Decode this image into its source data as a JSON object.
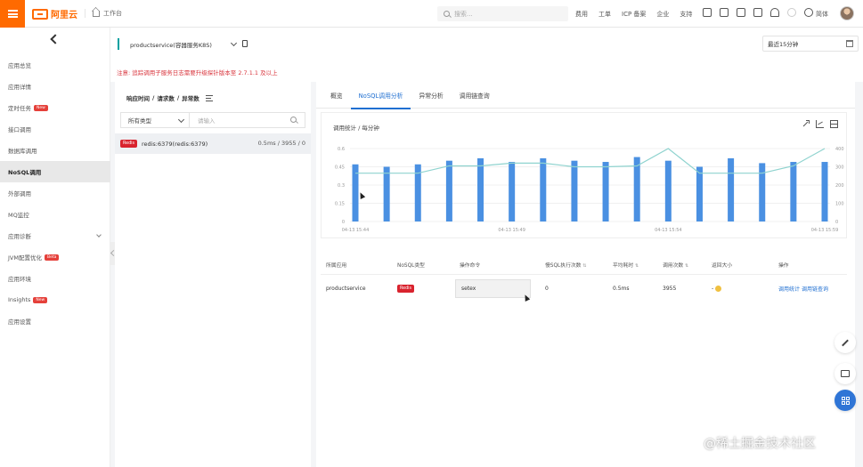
{
  "topbar": {
    "logo_text": "阿里云",
    "workbench": "工作台",
    "search_placeholder": "搜索...",
    "nav_links": [
      "费用",
      "工单",
      "ICP 备案",
      "企业",
      "支持"
    ],
    "lang": "简体"
  },
  "sidebar": {
    "items": [
      {
        "label": "应用总览",
        "badge": ""
      },
      {
        "label": "应用详情",
        "badge": ""
      },
      {
        "label": "定时任务",
        "badge": "New"
      },
      {
        "label": "接口调用",
        "badge": ""
      },
      {
        "label": "数据库调用",
        "badge": ""
      },
      {
        "label": "NoSQL调用",
        "badge": "",
        "active": true
      },
      {
        "label": "外部调用",
        "badge": ""
      },
      {
        "label": "MQ监控",
        "badge": ""
      },
      {
        "label": "应用诊断",
        "badge": "",
        "expandable": true
      },
      {
        "label": "JVM配置优化",
        "badge": "Beta"
      },
      {
        "label": "应用环境",
        "badge": ""
      },
      {
        "label": "Insights",
        "badge": "New"
      },
      {
        "label": "应用设置",
        "badge": ""
      }
    ]
  },
  "service_bar": {
    "service": "productservice(容器服务K8S)",
    "time_range": "最近15分钟"
  },
  "notice": "注意: 追踪调用子服务日志需要升级探针版本至 2.7.1.1 及以上",
  "left_panel": {
    "header": [
      "响应时间",
      "/",
      "请求数",
      "/",
      "异常数"
    ],
    "type_filter": "所有类型",
    "search_placeholder": "请输入",
    "rows": [
      {
        "tag": "Redis",
        "name": "redis:6379(redis:6379)",
        "stats": "0.5ms / 3955 / 0"
      }
    ]
  },
  "tabs": [
    "概览",
    "NoSQL调用分析",
    "异常分析",
    "调用链查询"
  ],
  "active_tab": 1,
  "chart": {
    "title": "调用统计 / 每分钟"
  },
  "chart_data": {
    "type": "bar",
    "categories": [
      "04-13 15:44",
      "",
      "",
      "",
      "",
      "04-13 15:49",
      "",
      "",
      "",
      "",
      "04-13 15:54",
      "",
      "",
      "",
      "",
      "04-13 15:59"
    ],
    "series": [
      {
        "name": "",
        "type": "bar",
        "axis": "left",
        "values": [
          0.47,
          0.45,
          0.47,
          0.5,
          0.52,
          0.49,
          0.52,
          0.5,
          0.49,
          0.53,
          0.5,
          0.45,
          0.52,
          0.48,
          0.49,
          0.49
        ]
      },
      {
        "name": "",
        "type": "line",
        "axis": "right",
        "values": [
          265,
          265,
          265,
          305,
          305,
          320,
          320,
          300,
          300,
          305,
          400,
          265,
          265,
          265,
          305,
          400
        ]
      }
    ],
    "y_left_ticks": [
      "0",
      "0.15",
      "0.3",
      "0.45",
      "0.6"
    ],
    "y_right_ticks": [
      "0",
      "100",
      "200",
      "300",
      "400"
    ],
    "x_ticks": [
      "04-13 15:44",
      "04-13 15:49",
      "04-13 15:54",
      "04-13 15:59"
    ],
    "ylim_left": [
      0,
      0.6
    ],
    "ylim_right": [
      0,
      400
    ],
    "colors": {
      "bar": "#4a90e2",
      "line": "#8fd3cf"
    }
  },
  "table": {
    "headers": [
      "所属应用",
      "NoSQL类型",
      "操作命令",
      "慢SQL执行次数",
      "平均耗时",
      "调用次数",
      "返回大小",
      "操作"
    ],
    "rows": [
      {
        "app": "productservice",
        "type": "Redis",
        "command": "setex",
        "slow": "0",
        "avg": "0.5ms",
        "calls": "3955",
        "size": "-",
        "actions": [
          "调用统计",
          "调用链查询"
        ]
      }
    ]
  },
  "watermark": "@稀土掘金技术社区"
}
